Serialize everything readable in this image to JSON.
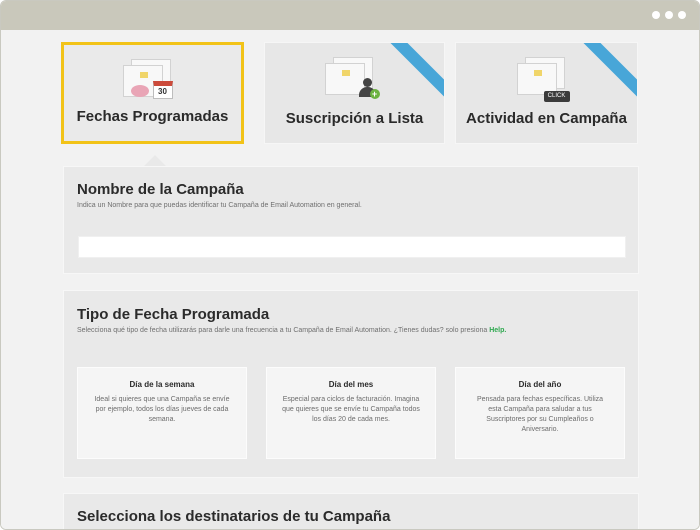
{
  "window": {
    "controls": [
      "dot",
      "dot",
      "dot"
    ]
  },
  "cards": [
    {
      "label": "Fechas Programadas",
      "icon": "calendar-envelope-icon",
      "calendar_day": "30",
      "selected": true
    },
    {
      "label": "Suscripción a Lista",
      "icon": "add-subscriber-envelope-icon",
      "ribbon": true
    },
    {
      "label": "Actividad en Campaña",
      "icon": "click-envelope-icon",
      "click_label": "CLICK",
      "ribbon": true
    }
  ],
  "name_section": {
    "title": "Nombre de la Campaña",
    "description": "Indica un Nombre para que puedas identificar tu Campaña de Email Automation en general.",
    "input_value": ""
  },
  "date_type_section": {
    "title": "Tipo de Fecha Programada",
    "description": "Selecciona qué tipo de fecha utilizarás para darle una frecuencia a tu Campaña de Email Automation. ¿Tienes dudas? solo presiona",
    "help_link": "Help.",
    "options": [
      {
        "title": "Día de la semana",
        "text": "Ideal si quieres que una Campaña se envíe por ejemplo, todos los días jueves de cada semana."
      },
      {
        "title": "Día del mes",
        "text": "Especial para ciclos de facturación. Imagina que quieres que se envíe tu Campaña todos los días 20 de cada mes."
      },
      {
        "title": "Día del año",
        "text": "Pensada para fechas específicas. Utiliza esta Campaña para saludar a tus Suscriptores por su Cumpleaños o Aniversario."
      }
    ]
  },
  "recipients_section": {
    "title": "Selecciona los destinatarios de tu Campaña"
  },
  "colors": {
    "titlebar": "#c9c8bb",
    "selected_border": "#f2c318",
    "ribbon": "#48a6d8",
    "link": "#2ea84f",
    "background": "#f2f2f2"
  }
}
